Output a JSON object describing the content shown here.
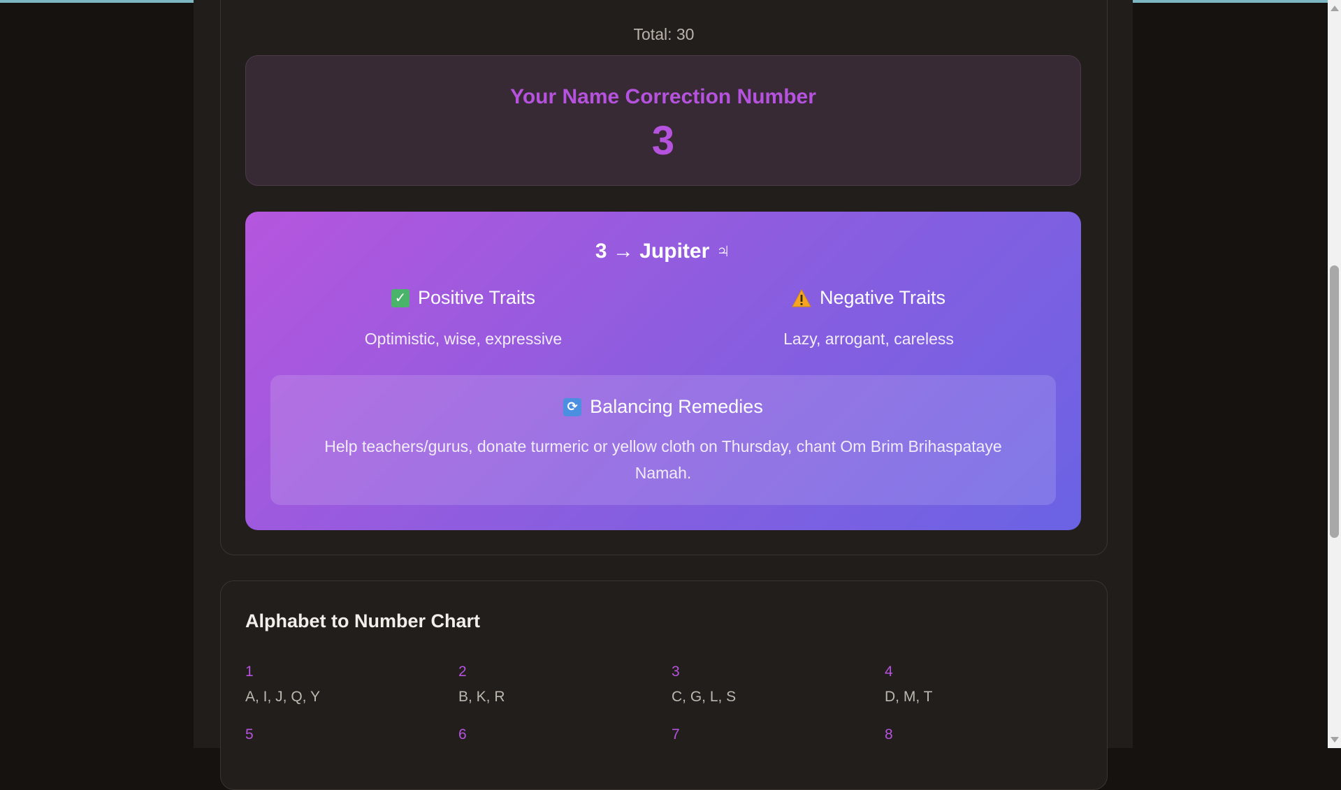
{
  "calculation": {
    "total_text": "Total: 30"
  },
  "result": {
    "heading": "Your Name Correction Number",
    "number": "3"
  },
  "planet": {
    "title": "3 → Jupiter ♃",
    "positive": {
      "heading": "Positive Traits",
      "text": "Optimistic, wise, expressive",
      "icon": "check-mark-icon"
    },
    "negative": {
      "heading": "Negative Traits",
      "text": "Lazy, arrogant, careless",
      "icon": "warning-icon"
    },
    "remedies": {
      "heading": "Balancing Remedies",
      "text": "Help teachers/gurus, donate turmeric or yellow cloth on Thursday, chant Om Brim Brihaspataye Namah.",
      "icon": "refresh-icon"
    }
  },
  "chart": {
    "title": "Alphabet to Number Chart",
    "items": [
      {
        "number": "1",
        "letters": "A, I, J, Q, Y"
      },
      {
        "number": "2",
        "letters": "B, K, R"
      },
      {
        "number": "3",
        "letters": "C, G, L, S"
      },
      {
        "number": "4",
        "letters": "D, M, T"
      },
      {
        "number": "5",
        "letters": ""
      },
      {
        "number": "6",
        "letters": ""
      },
      {
        "number": "7",
        "letters": ""
      },
      {
        "number": "8",
        "letters": ""
      }
    ]
  },
  "colors": {
    "accent": "#b653de",
    "gradient_start": "#b556de",
    "gradient_end": "#6a63e4",
    "background": "#211d1a"
  }
}
